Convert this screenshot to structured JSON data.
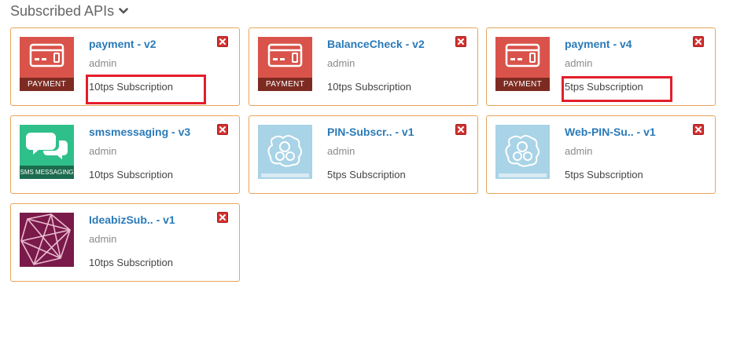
{
  "header": {
    "title": "Subscribed APIs",
    "toggle_icon": "chevron-down-icon"
  },
  "icon_labels": {
    "payment": "PAYMENT",
    "sms": "SMS MESSAGING"
  },
  "apis": [
    {
      "name": "payment - v2",
      "owner": "admin",
      "tier": "10tps Subscription",
      "thumbnail": "payment"
    },
    {
      "name": "BalanceCheck - v2",
      "owner": "admin",
      "tier": "10tps Subscription",
      "thumbnail": "payment"
    },
    {
      "name": "payment - v4",
      "owner": "admin",
      "tier": "5tps Subscription",
      "thumbnail": "payment"
    },
    {
      "name": "smsmessaging - v3",
      "owner": "admin",
      "tier": "10tps Subscription",
      "thumbnail": "sms"
    },
    {
      "name": "PIN-Subscr.. - v1",
      "owner": "admin",
      "tier": "5tps Subscription",
      "thumbnail": "default-gears"
    },
    {
      "name": "Web-PIN-Su.. - v1",
      "owner": "admin",
      "tier": "5tps Subscription",
      "thumbnail": "default-gears"
    },
    {
      "name": "IdeabizSub.. - v1",
      "owner": "admin",
      "tier": "10tps Subscription",
      "thumbnail": "polygon-pattern"
    }
  ],
  "colors": {
    "card_border": "#e8a55a",
    "link": "#2a7ab8",
    "remove": "#d33131",
    "highlight": "#e31e2b",
    "payment_tile": "#d9534a",
    "sms_tile": "#2fbf8a",
    "gears_tile": "#a9d3e6",
    "polygon_tile": "#7a1a4a"
  }
}
